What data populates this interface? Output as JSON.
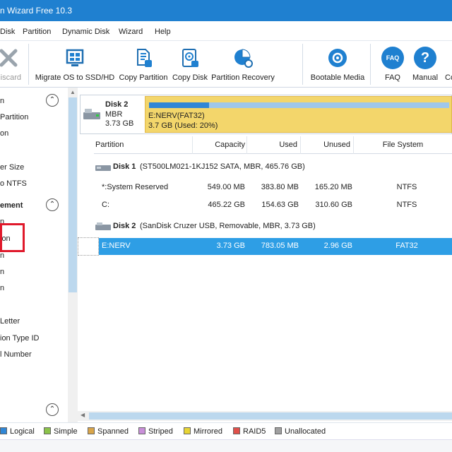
{
  "window": {
    "title": "n Wizard Free 10.3"
  },
  "menu": [
    "Disk",
    "Partition",
    "Dynamic Disk",
    "Wizard",
    "Help"
  ],
  "toolbar": {
    "discard": "iscard",
    "migrate": "Migrate OS to SSD/HD",
    "copy_partition": "Copy Partition",
    "copy_disk": "Copy Disk",
    "partition_recovery": "Partition Recovery",
    "bootable_media": "Bootable Media",
    "faq": "FAQ",
    "faq_badge": "FAQ",
    "manual": "Manual",
    "contact": "Co"
  },
  "sidebar": {
    "items": [
      "n",
      "Partition",
      "on",
      "er Size",
      "o NTFS",
      "ement",
      "n",
      "ion",
      "n",
      "n",
      "n",
      "Letter",
      "ion Type ID",
      "l Number"
    ]
  },
  "disk_card": {
    "name": "Disk 2",
    "type": "MBR",
    "size": "3.73 GB",
    "partition_label": "E:NERV(FAT32)",
    "partition_usage": "3.7 GB (Used: 20%)",
    "used_fraction": 0.2
  },
  "table": {
    "headers": [
      "Partition",
      "Capacity",
      "Used",
      "Unused",
      "File System"
    ],
    "disk1": {
      "name": "Disk 1",
      "detail": "(ST500LM021-1KJ152 SATA, MBR, 465.76 GB)"
    },
    "disk1_rows": [
      [
        "*:System Reserved",
        "549.00 MB",
        "383.80 MB",
        "165.20 MB",
        "NTFS"
      ],
      [
        "C:",
        "465.22 GB",
        "154.63 GB",
        "310.60 GB",
        "NTFS"
      ]
    ],
    "disk2": {
      "name": "Disk 2",
      "detail": "(SanDisk Cruzer USB, Removable, MBR, 3.73 GB)"
    },
    "disk2_rows": [
      [
        "E:NERV",
        "3.73 GB",
        "783.05 MB",
        "2.96 GB",
        "FAT32"
      ]
    ]
  },
  "legend": [
    {
      "label": "Logical",
      "color": "#2f86d6"
    },
    {
      "label": "Simple",
      "color": "#8bc34a"
    },
    {
      "label": "Spanned",
      "color": "#d9a54a"
    },
    {
      "label": "Striped",
      "color": "#c98fd9"
    },
    {
      "label": "Mirrored",
      "color": "#e8d534"
    },
    {
      "label": "RAID5",
      "color": "#e0504a"
    },
    {
      "label": "Unallocated",
      "color": "#a0a0a0"
    }
  ],
  "colors": {
    "accent": "#1f80d0",
    "selection": "#2e9ee5",
    "partition_bar": "#f3d66b",
    "highlight_box": "#e0192b"
  }
}
